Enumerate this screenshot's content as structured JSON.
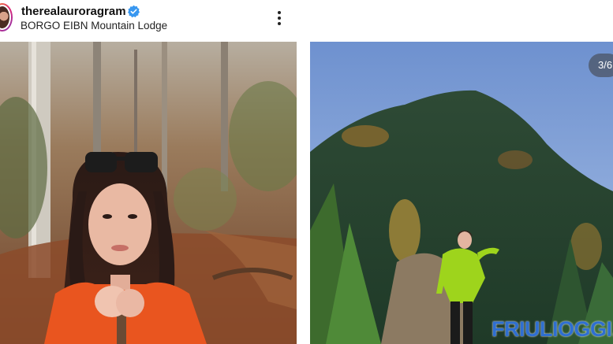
{
  "post_header": {
    "username": "therealauroragram",
    "verified": true,
    "location": "BORGO EIBN Mountain Lodge",
    "more_icon": "more-vertical-icon"
  },
  "carousel": {
    "counter": "3/6",
    "photos": [
      {
        "name": "photo-woman-forest-selfie"
      },
      {
        "name": "photo-woman-mountain-viewpoint"
      }
    ]
  },
  "watermark": {
    "text": "FRIULIOGGI.IT"
  },
  "colors": {
    "verified_blue": "#3897f0",
    "watermark_blue": "#2f6fd1"
  }
}
